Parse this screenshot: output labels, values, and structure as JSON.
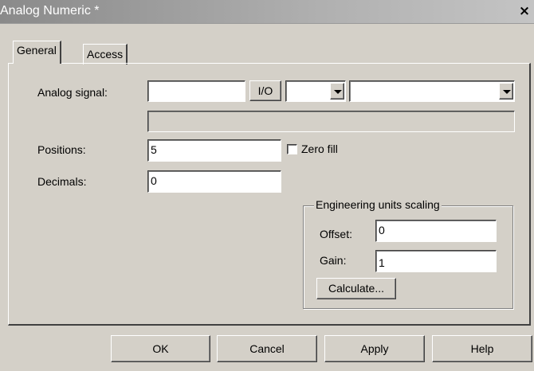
{
  "window": {
    "title": "Analog Numeric *",
    "close_label": "×"
  },
  "tabs": [
    {
      "label": "General"
    },
    {
      "label": "Access"
    }
  ],
  "general": {
    "analog_signal_label": "Analog signal:",
    "signal_value": "",
    "io_button": "I/O",
    "type_dropdown_value": "",
    "signal_dropdown_value": "",
    "signal_description": "",
    "positions_label": "Positions:",
    "positions_value": "5",
    "zero_fill_label": "Zero fill",
    "zero_fill_checked": false,
    "decimals_label": "Decimals:",
    "decimals_value": "0",
    "scaling_group_label": "Engineering units scaling",
    "offset_label": "Offset:",
    "offset_value": "0",
    "gain_label": "Gain:",
    "gain_value": "1",
    "calculate_button": "Calculate..."
  },
  "buttons": {
    "ok": "OK",
    "cancel": "Cancel",
    "apply": "Apply",
    "help": "Help"
  }
}
